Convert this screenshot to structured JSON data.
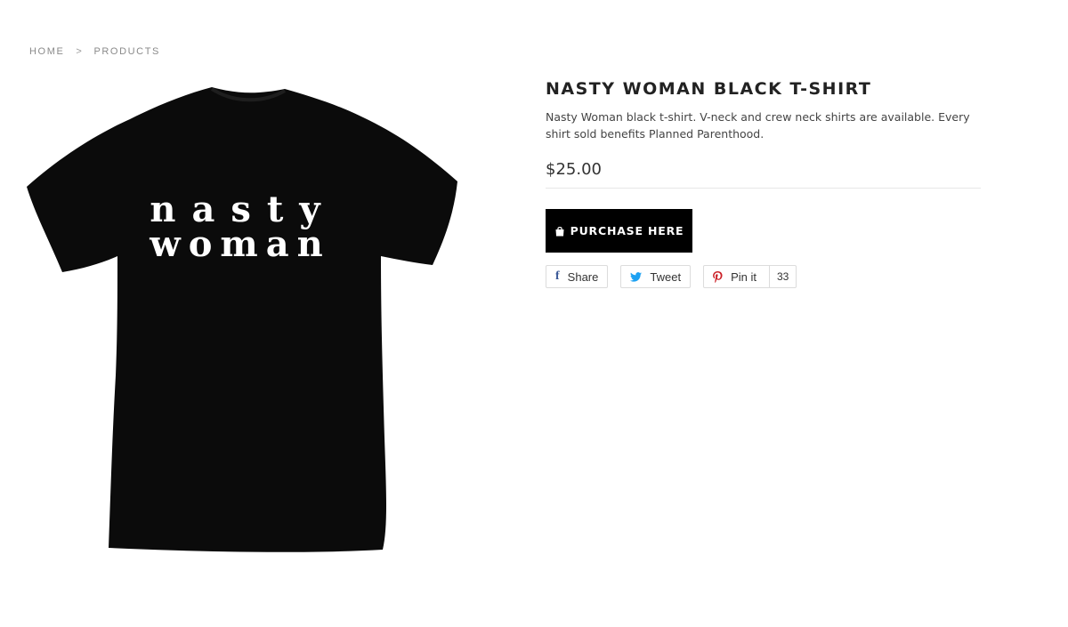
{
  "breadcrumb": {
    "home": "HOME",
    "separator": ">",
    "current": "PRODUCTS"
  },
  "product": {
    "title": "NASTY WOMAN BLACK T-SHIRT",
    "description": "Nasty Woman black t-shirt. V-neck and crew neck shirts are available. Every shirt sold benefits Planned Parenthood.",
    "price": "$25.00",
    "image": {
      "shirt_color": "#0b0b0b",
      "print_line1": "nasty",
      "print_line2": "woman",
      "print_color": "#ffffff"
    },
    "purchase_button": {
      "label": "PURCHASE HERE",
      "icon": "shopping-bag-icon"
    }
  },
  "share": {
    "facebook": {
      "label": "Share",
      "icon": "facebook-icon",
      "color": "#3b5998"
    },
    "twitter": {
      "label": "Tweet",
      "icon": "twitter-icon",
      "color": "#1da1f2"
    },
    "pinterest": {
      "label": "Pin it",
      "icon": "pinterest-icon",
      "color": "#cb2027",
      "count": "33"
    }
  }
}
